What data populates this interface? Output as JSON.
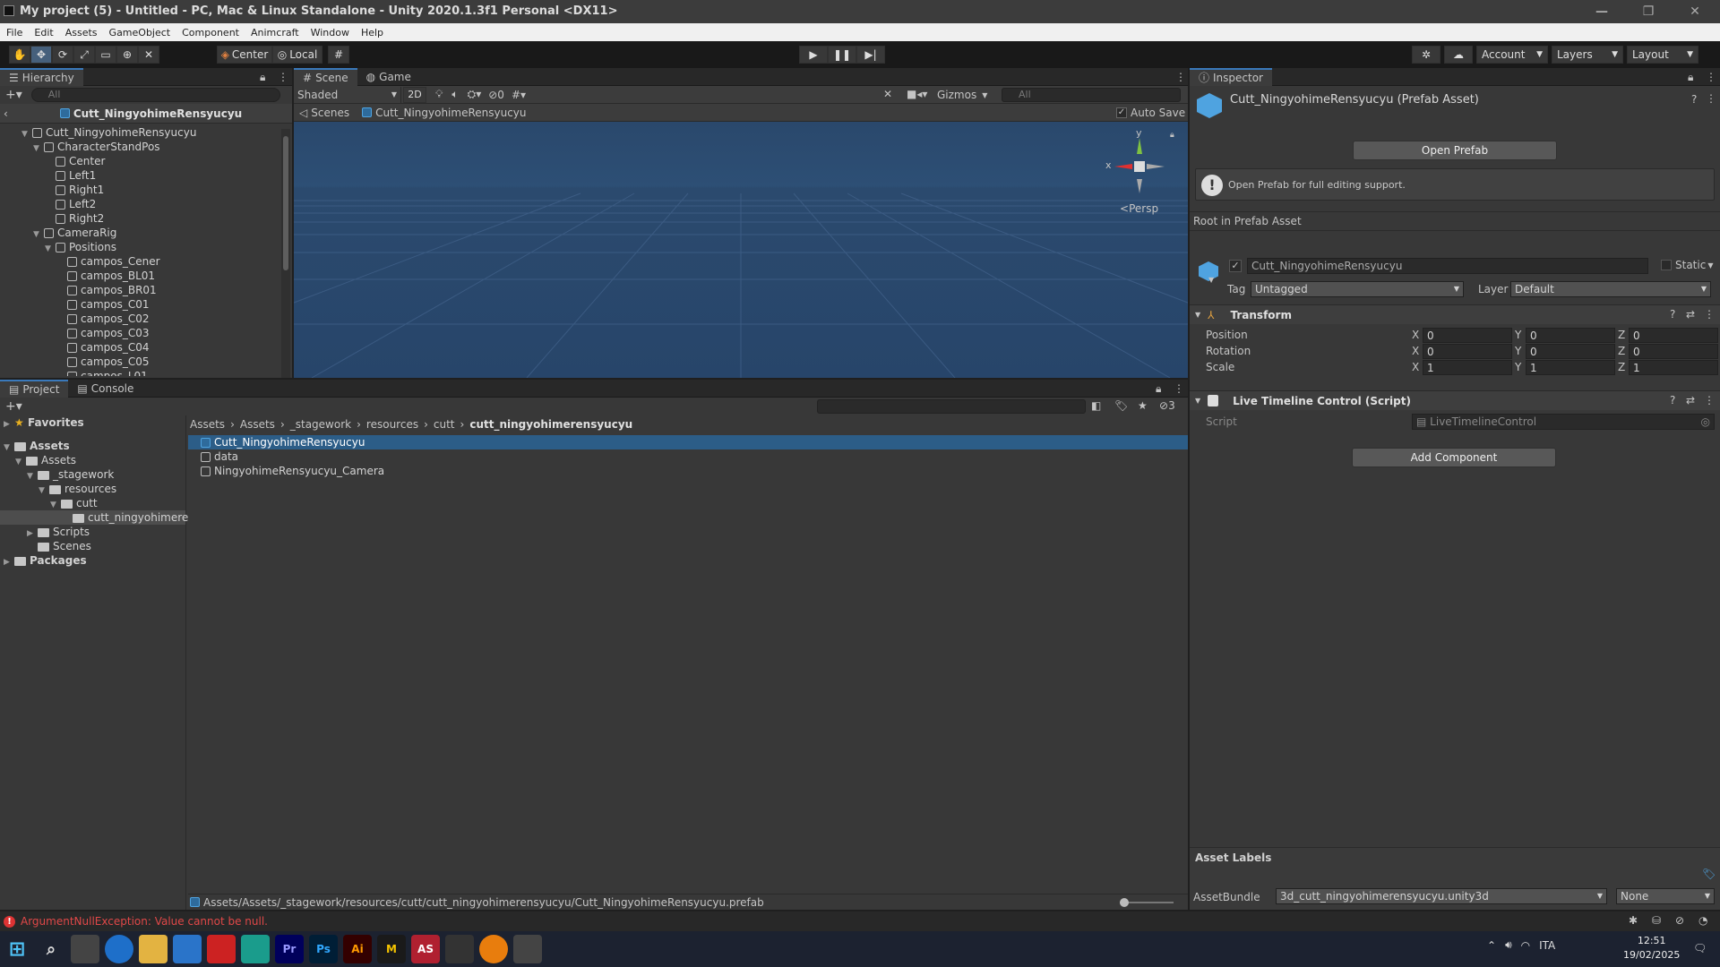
{
  "window": {
    "title": "My project (5) - Untitled - PC, Mac & Linux Standalone - Unity 2020.1.3f1 Personal <DX11>"
  },
  "menu": [
    "File",
    "Edit",
    "Assets",
    "GameObject",
    "Component",
    "Animcraft",
    "Window",
    "Help"
  ],
  "toolbar": {
    "center_label": "Center",
    "local_label": "Local",
    "account_label": "Account",
    "layers_label": "Layers",
    "layout_label": "Layout"
  },
  "hierarchy": {
    "tab_label": "Hierarchy",
    "search_placeholder": "All",
    "prefab_title": "Cutt_NingyohimeRensyucyu",
    "items": [
      {
        "label": "Cutt_NingyohimeRensyucyu",
        "depth": 0,
        "expanded": true
      },
      {
        "label": "CharacterStandPos",
        "depth": 1,
        "expanded": true
      },
      {
        "label": "Center",
        "depth": 2,
        "expanded": false
      },
      {
        "label": "Left1",
        "depth": 2,
        "expanded": false
      },
      {
        "label": "Right1",
        "depth": 2,
        "expanded": false
      },
      {
        "label": "Left2",
        "depth": 2,
        "expanded": false
      },
      {
        "label": "Right2",
        "depth": 2,
        "expanded": false
      },
      {
        "label": "CameraRig",
        "depth": 1,
        "expanded": true
      },
      {
        "label": "Positions",
        "depth": 2,
        "expanded": true
      },
      {
        "label": "campos_Cener",
        "depth": 3,
        "expanded": false
      },
      {
        "label": "campos_BL01",
        "depth": 3,
        "expanded": false
      },
      {
        "label": "campos_BR01",
        "depth": 3,
        "expanded": false
      },
      {
        "label": "campos_C01",
        "depth": 3,
        "expanded": false
      },
      {
        "label": "campos_C02",
        "depth": 3,
        "expanded": false
      },
      {
        "label": "campos_C03",
        "depth": 3,
        "expanded": false
      },
      {
        "label": "campos_C04",
        "depth": 3,
        "expanded": false
      },
      {
        "label": "campos_C05",
        "depth": 3,
        "expanded": false
      },
      {
        "label": "campos_L01",
        "depth": 3,
        "expanded": false
      }
    ]
  },
  "scene": {
    "tab_scene": "Scene",
    "tab_game": "Game",
    "shading": "Shaded",
    "mode_2d": "2D",
    "hidden_count": "0",
    "gizmos": "Gizmos",
    "search_placeholder": "All",
    "breadcrumb_scenes": "Scenes",
    "breadcrumb_prefab": "Cutt_NingyohimeRensyucyu",
    "auto_save": "Auto Save",
    "persp": "Persp",
    "axis_x": "x",
    "axis_y": "y"
  },
  "inspector": {
    "tab_label": "Inspector",
    "asset_title": "Cutt_NingyohimeRensyucyu (Prefab Asset)",
    "open_prefab": "Open Prefab",
    "info": "Open Prefab for full editing support.",
    "root_label": "Root in Prefab Asset",
    "object_name": "Cutt_NingyohimeRensyucyu",
    "static_label": "Static",
    "tag_label": "Tag",
    "tag_value": "Untagged",
    "layer_label": "Layer",
    "layer_value": "Default",
    "transform": {
      "title": "Transform",
      "rows": [
        {
          "label": "Position",
          "x": "0",
          "y": "0",
          "z": "0"
        },
        {
          "label": "Rotation",
          "x": "0",
          "y": "0",
          "z": "0"
        },
        {
          "label": "Scale",
          "x": "1",
          "y": "1",
          "z": "1"
        }
      ]
    },
    "component": {
      "title": "Live Timeline Control (Script)",
      "script_label": "Script",
      "script_value": "LiveTimelineControl"
    },
    "add_component": "Add Component",
    "asset_labels": "Asset Labels",
    "assetbundle_label": "AssetBundle",
    "assetbundle_value": "3d_cutt_ningyohimerensyucyu.unity3d",
    "variant_value": "None"
  },
  "project": {
    "tab_project": "Project",
    "tab_console": "Console",
    "hidden_count": "3",
    "favorites": "Favorites",
    "tree": [
      {
        "label": "Assets",
        "depth": 0,
        "bold": true
      },
      {
        "label": "Assets",
        "depth": 1,
        "bold": false
      },
      {
        "label": "_stagework",
        "depth": 2,
        "bold": false
      },
      {
        "label": "resources",
        "depth": 3,
        "bold": false
      },
      {
        "label": "cutt",
        "depth": 4,
        "bold": false
      },
      {
        "label": "cutt_ningyohimere",
        "depth": 5,
        "bold": false
      },
      {
        "label": "Scripts",
        "depth": 2,
        "bold": false
      },
      {
        "label": "Scenes",
        "depth": 2,
        "bold": false
      },
      {
        "label": "Packages",
        "depth": 0,
        "bold": true
      }
    ],
    "breadcrumb": [
      "Assets",
      "Assets",
      "_stagework",
      "resources",
      "cutt",
      "cutt_ningyohimerensyucyu"
    ],
    "files": [
      {
        "label": "Cutt_NingyohimeRensyucyu",
        "selected": true
      },
      {
        "label": "data",
        "selected": false
      },
      {
        "label": "NingyohimeRensyucyu_Camera",
        "selected": false
      }
    ],
    "path": "Assets/Assets/_stagework/resources/cutt/cutt_ningyohimerensyucyu/Cutt_NingyohimeRensyucyu.prefab"
  },
  "status": {
    "error": "ArgumentNullException: Value cannot be null."
  },
  "taskbar": {
    "lang": "ITA",
    "time": "12:51",
    "date": "19/02/2025",
    "apps": [
      {
        "name": "Pr",
        "bg": "#00005b",
        "fg": "#9999ff"
      },
      {
        "name": "Ps",
        "bg": "#001e36",
        "fg": "#31a8ff"
      },
      {
        "name": "Ai",
        "bg": "#330000",
        "fg": "#ff9a00"
      },
      {
        "name": "M",
        "bg": "#1a1a1a",
        "fg": "#f5c400"
      },
      {
        "name": "AS",
        "bg": "#b02030",
        "fg": "#ffffff"
      }
    ]
  }
}
